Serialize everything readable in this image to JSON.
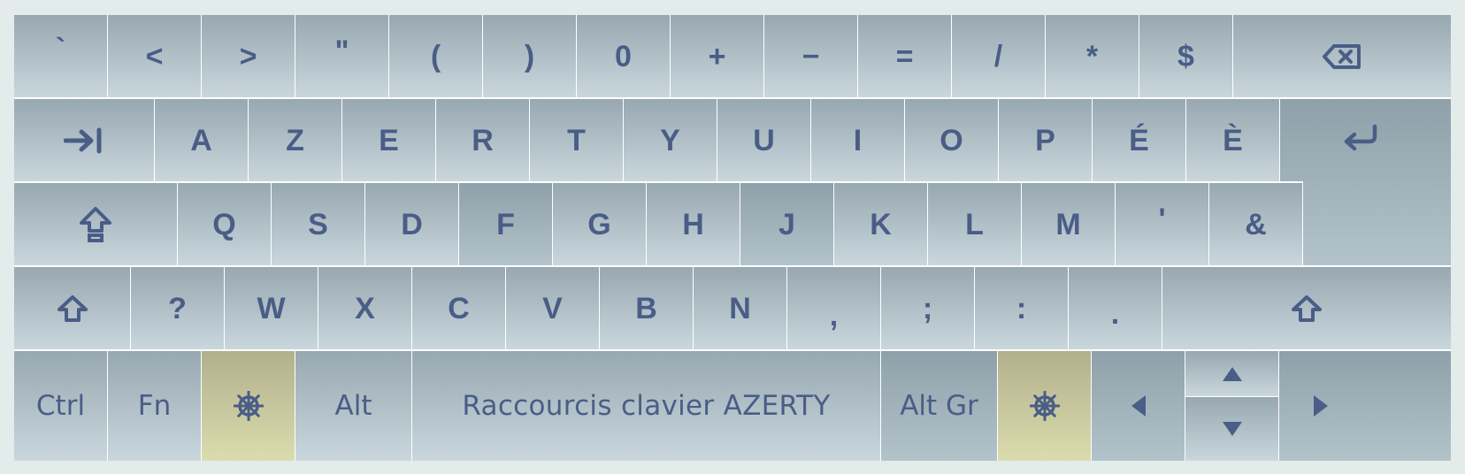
{
  "keyboard": {
    "layout_name": "AZERTY",
    "colors": {
      "key_gradient_top": "#98a8b0",
      "key_gradient_bottom": "#c9d7dd",
      "special_key_gradient_top": "#b2b08c",
      "special_key_gradient_bottom": "#dbdcae",
      "label": "#4a5d87",
      "border": "#ffffff",
      "page_background": "#e3eceb"
    },
    "row1": {
      "backtick": "`",
      "less": "<",
      "greater": ">",
      "quote": "\"",
      "paren_open": "(",
      "paren_close": ")",
      "zero": "0",
      "plus": "+",
      "minus": "−",
      "equals": "=",
      "slash": "/",
      "asterisk": "*",
      "dollar": "$",
      "backspace_icon": "backspace-icon"
    },
    "row2": {
      "tab_icon": "tab-icon",
      "letters": [
        "A",
        "Z",
        "E",
        "R",
        "T",
        "Y",
        "U",
        "I",
        "O",
        "P",
        "É",
        "È"
      ],
      "enter_icon": "enter-icon"
    },
    "row3": {
      "caps_lock_icon": "caps-lock-icon",
      "letters": [
        "Q",
        "S",
        "D",
        "F",
        "G",
        "H",
        "J",
        "K",
        "L",
        "M",
        "'",
        "&"
      ]
    },
    "row4": {
      "shift_icon": "shift-icon",
      "keys": [
        "?",
        "W",
        "X",
        "C",
        "V",
        "B",
        "N",
        ",",
        ";",
        ":",
        "."
      ]
    },
    "row5": {
      "ctrl": "Ctrl",
      "fn": "Fn",
      "helm_icon": "ship-wheel-icon",
      "alt": "Alt",
      "space": "Raccourcis clavier AZERTY",
      "alt_gr": "Alt Gr",
      "arrows": [
        "arrow-left-icon",
        "arrow-up-icon",
        "arrow-down-icon",
        "arrow-right-icon"
      ]
    }
  }
}
